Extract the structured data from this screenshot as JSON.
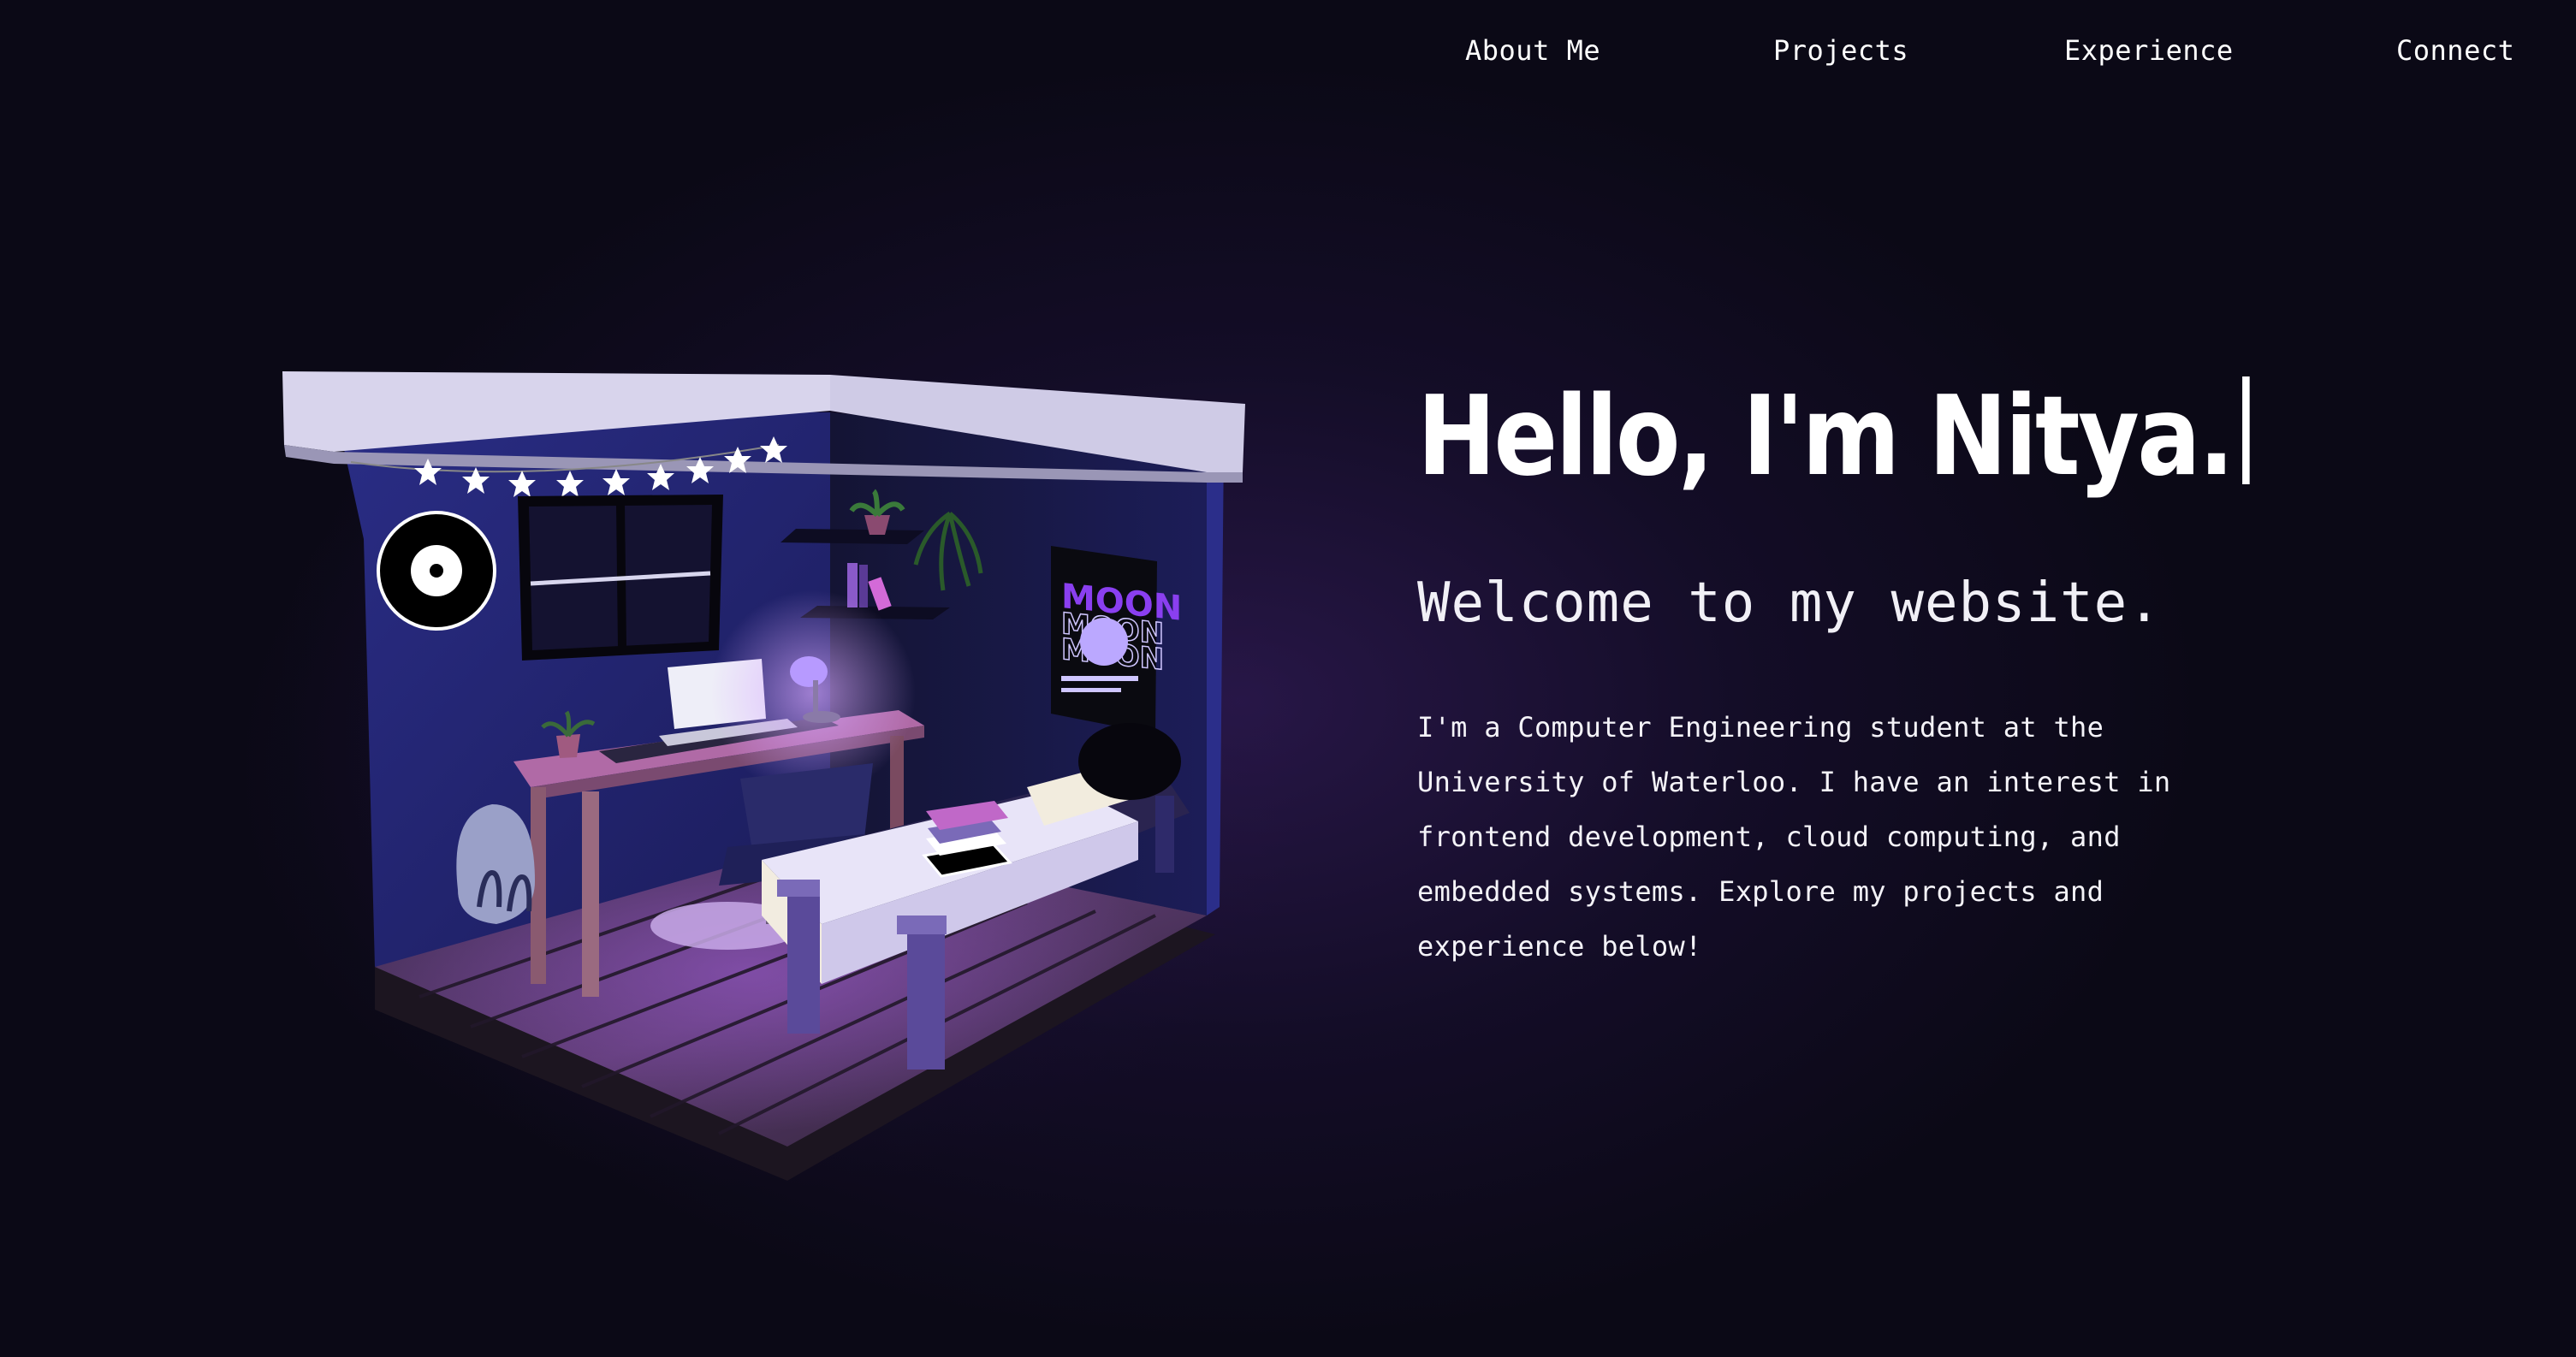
{
  "nav": {
    "items": [
      {
        "label": "About Me"
      },
      {
        "label": "Projects"
      },
      {
        "label": "Experience"
      },
      {
        "label": "Connect"
      }
    ]
  },
  "hero": {
    "headline": "Hello, I'm Nitya.",
    "subheadline": "Welcome to my website.",
    "bio": "I'm a Computer Engineering student at the University of Waterloo. I have an interest in frontend development, cloud computing, and embedded systems. Explore my projects and experience below!"
  },
  "poster": {
    "title": "MOON"
  },
  "colors": {
    "background": "#0b0916",
    "accent_purple": "#7a3fd0",
    "wall": "#23246e",
    "text": "#ffffff"
  }
}
